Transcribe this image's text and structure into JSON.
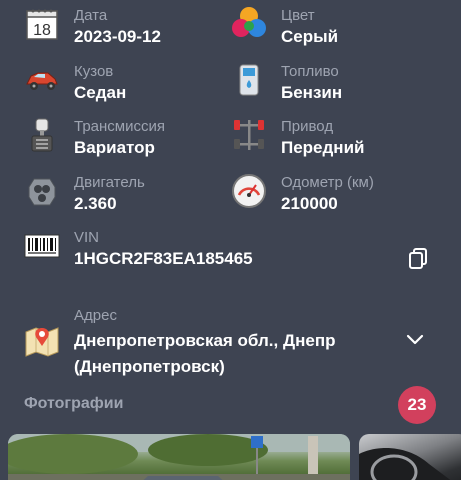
{
  "specs": {
    "date": {
      "label": "Дата",
      "value": "2023-09-12",
      "calendar_day": "18",
      "icon": "calendar-icon"
    },
    "color": {
      "label": "Цвет",
      "value": "Серый",
      "icon": "color-palette-icon"
    },
    "body": {
      "label": "Кузов",
      "value": "Седан",
      "icon": "car-body-icon"
    },
    "fuel": {
      "label": "Топливо",
      "value": "Бензин",
      "icon": "fuel-pump-icon"
    },
    "transmission": {
      "label": "Трансмиссия",
      "value": "Вариатор",
      "icon": "gear-shift-icon"
    },
    "drive": {
      "label": "Привод",
      "value": "Передний",
      "icon": "drivetrain-icon"
    },
    "engine": {
      "label": "Двигатель",
      "value": "2.360",
      "icon": "engine-icon"
    },
    "odometer": {
      "label": "Одометр (км)",
      "value": "210000",
      "icon": "odometer-icon"
    },
    "vin": {
      "label": "VIN",
      "value": "1HGCR2F83EA185465",
      "icon": "barcode-icon"
    },
    "address": {
      "label": "Адрес",
      "value_line1": "Днепропетровская обл., Днепр",
      "value_line2": "(Днепропетровск)",
      "icon": "map-pin-icon"
    }
  },
  "photos": {
    "title": "Фотографии",
    "count": "23"
  },
  "colors": {
    "background": "#3e4452",
    "label": "#9ea4b1",
    "badge": "#d2405d"
  }
}
